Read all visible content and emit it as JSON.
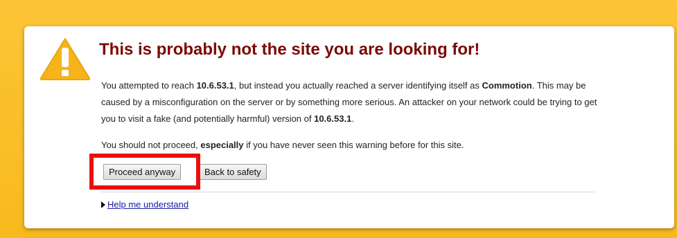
{
  "page": {
    "title": "This is probably not the site you are looking for!",
    "paragraph1": {
      "t1": "You attempted to reach ",
      "b1": "10.6.53.1",
      "t2": ", but instead you actually reached a server identifying itself as ",
      "b2": "Commotion",
      "t3": ". This may be caused by a misconfiguration on the server or by something more serious. An attacker on your network could be trying to get you to visit a fake (and potentially harmful) version of ",
      "b3": "10.6.53.1",
      "t4": "."
    },
    "paragraph2": {
      "t1": "You should not proceed, ",
      "b1": "especially",
      "t2": " if you have never seen this warning before for this site."
    },
    "buttons": {
      "proceed": "Proceed anyway",
      "back": "Back to safety"
    },
    "help_link": "Help me understand"
  },
  "colors": {
    "background": "#fbc02d",
    "title": "#7a0a05",
    "highlight_box": "#ea0e0e",
    "link": "#1a1aa6"
  },
  "icons": {
    "warning": "warning-triangle-icon",
    "expand": "triangle-right-icon"
  }
}
